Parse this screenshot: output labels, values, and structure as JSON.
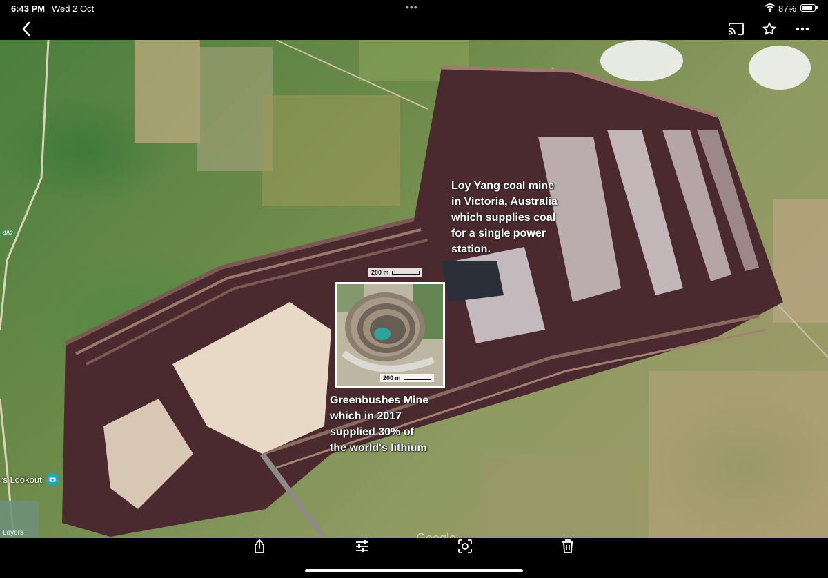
{
  "status_bar": {
    "time": "6:43 PM",
    "date": "Wed 2 Oct",
    "battery_percent": "87%",
    "battery_level": 0.87
  },
  "toolbar": {
    "back_icon": "chevron-left-icon",
    "cast_icon": "cast-icon",
    "favorite_icon": "star-icon",
    "more_icon": "more-horizontal-icon"
  },
  "map": {
    "caption_coal_mine": [
      "Loy Yang coal mine",
      "in Victoria, Australia",
      "which supplies coal",
      "for a single power",
      "station."
    ],
    "caption_greenbushes": [
      "Greenbushes Mine",
      "which in 2017",
      "supplied 30% of",
      "the world's lithium"
    ],
    "scale_main": "200 m",
    "scale_inset": "200 m",
    "lookout_label": "rs Lookout",
    "layers_label": "Layers",
    "road_badge": "482",
    "watermark": "Google"
  },
  "bottom_toolbar": {
    "share_icon": "share-icon",
    "adjust_icon": "sliders-icon",
    "crop_icon": "crop-focus-icon",
    "delete_icon": "trash-icon"
  },
  "colors": {
    "background": "#000000",
    "mine_dark": "#4a2a2e",
    "mine_pale": "#e8d9c6",
    "water_teal": "#2fa39a",
    "grass_green": "#4a7f3e"
  }
}
